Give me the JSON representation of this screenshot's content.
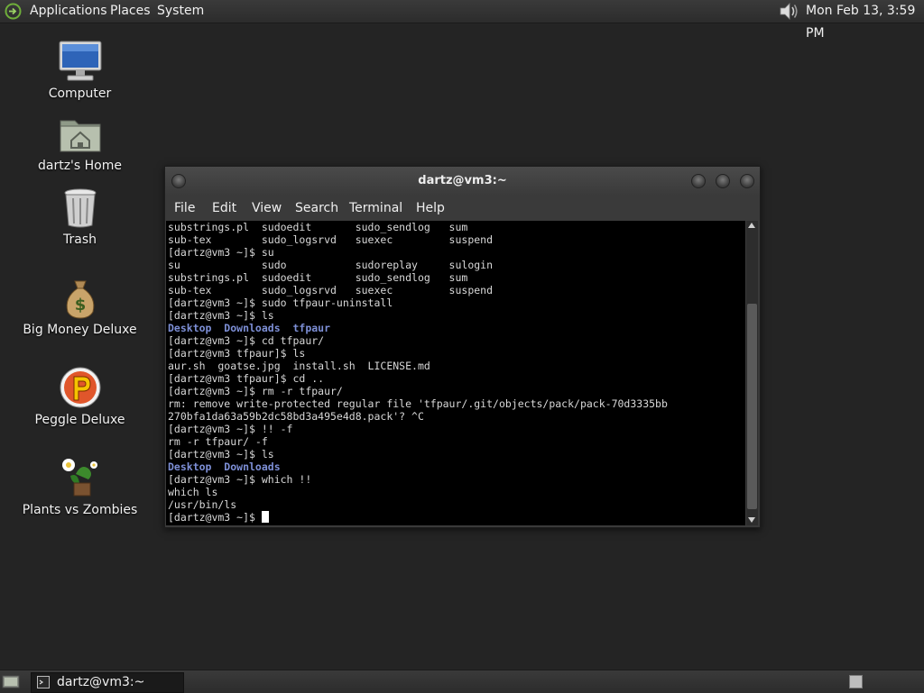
{
  "top_panel": {
    "menus": [
      "Applications",
      "Places",
      "System"
    ],
    "clock": "Mon Feb 13,  3:59 PM"
  },
  "desktop_icons": [
    {
      "label": "Computer",
      "icon": "computer-icon"
    },
    {
      "label": "dartz's Home",
      "icon": "home-folder-icon"
    },
    {
      "label": "Trash",
      "icon": "trash-icon"
    },
    {
      "label": "Big Money Deluxe",
      "icon": "money-bag-icon"
    },
    {
      "label": "Peggle Deluxe",
      "icon": "peggle-icon"
    },
    {
      "label": "Plants vs Zombies",
      "icon": "plants-vs-zombies-icon"
    }
  ],
  "terminal": {
    "title": "dartz@vm3:~",
    "menu": [
      "File",
      "Edit",
      "View",
      "Search",
      "Terminal",
      "Help"
    ],
    "lines": [
      "substrings.pl  sudoedit       sudo_sendlog   sum",
      "sub-tex        sudo_logsrvd   suexec         suspend",
      "[dartz@vm3 ~]$ su",
      "su             sudo           sudoreplay     sulogin",
      "substrings.pl  sudoedit       sudo_sendlog   sum",
      "sub-tex        sudo_logsrvd   suexec         suspend",
      "[dartz@vm3 ~]$ sudo tfpaur-uninstall",
      "[dartz@vm3 ~]$ ls",
      "Desktop  Downloads  tfpaur",
      "[dartz@vm3 ~]$ cd tfpaur/",
      "[dartz@vm3 tfpaur]$ ls",
      "aur.sh  goatse.jpg  install.sh  LICENSE.md",
      "[dartz@vm3 tfpaur]$ cd ..",
      "[dartz@vm3 ~]$ rm -r tfpaur/",
      "rm: remove write-protected regular file 'tfpaur/.git/objects/pack/pack-70d3335bb",
      "270bfa1da63a59b2dc58bd3a495e4d8.pack'? ^C",
      "[dartz@vm3 ~]$ !! -f",
      "rm -r tfpaur/ -f",
      "[dartz@vm3 ~]$ ls",
      "Desktop  Downloads",
      "[dartz@vm3 ~]$ which !!",
      "which ls",
      "/usr/bin/ls",
      "[dartz@vm3 ~]$ "
    ],
    "directory_lines": [
      8,
      19
    ],
    "colors": {
      "background": "#000000",
      "text": "#d8d8d8",
      "directory": "#7d8fd6"
    }
  },
  "bottom_panel": {
    "task_label": "dartz@vm3:~"
  }
}
